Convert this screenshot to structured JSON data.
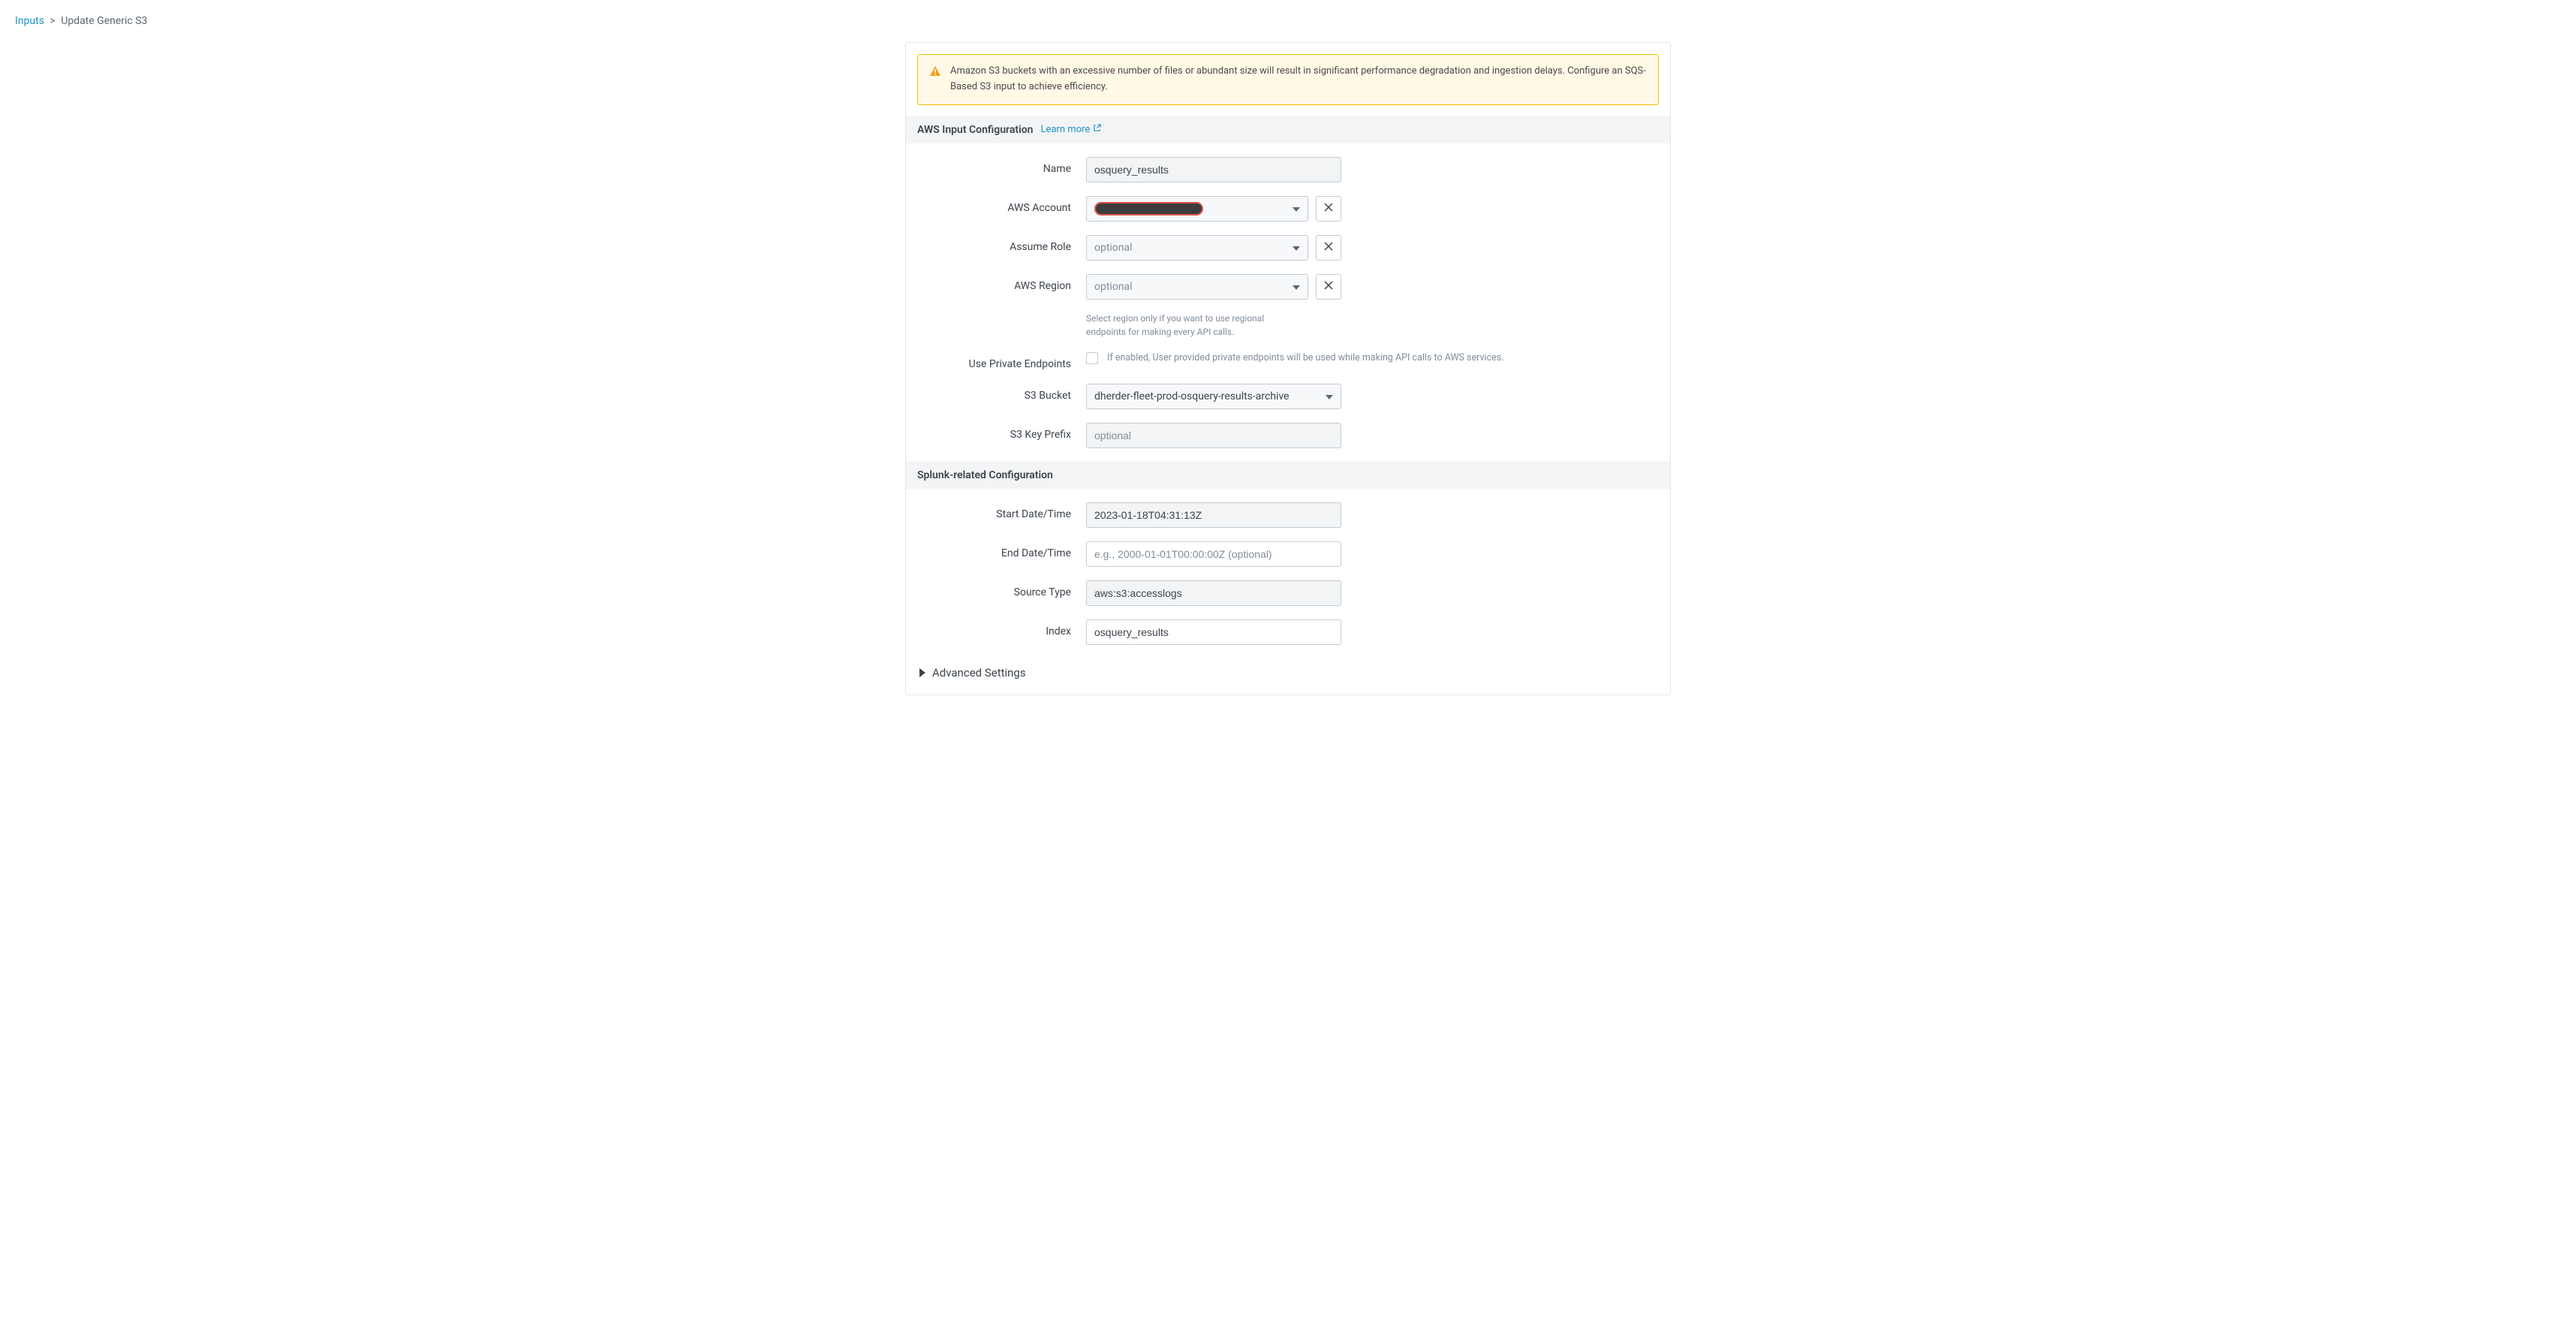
{
  "breadcrumb": {
    "link": "Inputs",
    "current": "Update Generic S3"
  },
  "alert": {
    "text": "Amazon S3 buckets with an excessive number of files or abundant size will result in significant performance degradation and ingestion delays. Configure an SQS-Based S3 input to achieve efficiency."
  },
  "section1": {
    "title": "AWS Input Configuration",
    "learn_more": "Learn more"
  },
  "fields": {
    "name": {
      "label": "Name",
      "value": "osquery_results"
    },
    "aws_account": {
      "label": "AWS Account",
      "value": ""
    },
    "assume_role": {
      "label": "Assume Role",
      "placeholder": "optional"
    },
    "aws_region": {
      "label": "AWS Region",
      "placeholder": "optional",
      "help": "Select region only if you want to use regional endpoints for making every API calls."
    },
    "private_endpoints": {
      "label": "Use Private Endpoints",
      "help": "If enabled, User provided private endpoints will be used while making API calls to AWS services."
    },
    "s3_bucket": {
      "label": "S3 Bucket",
      "value": "dherder-fleet-prod-osquery-results-archive"
    },
    "s3_key_prefix": {
      "label": "S3 Key Prefix",
      "placeholder": "optional"
    }
  },
  "section2": {
    "title": "Splunk-related Configuration"
  },
  "splunk_fields": {
    "start_datetime": {
      "label": "Start Date/Time",
      "value": "2023-01-18T04:31:13Z"
    },
    "end_datetime": {
      "label": "End Date/Time",
      "placeholder": "e.g., 2000-01-01T00:00:00Z (optional)"
    },
    "source_type": {
      "label": "Source Type",
      "value": "aws:s3:accesslogs"
    },
    "index": {
      "label": "Index",
      "value": "osquery_results"
    }
  },
  "advanced": {
    "label": "Advanced Settings"
  }
}
